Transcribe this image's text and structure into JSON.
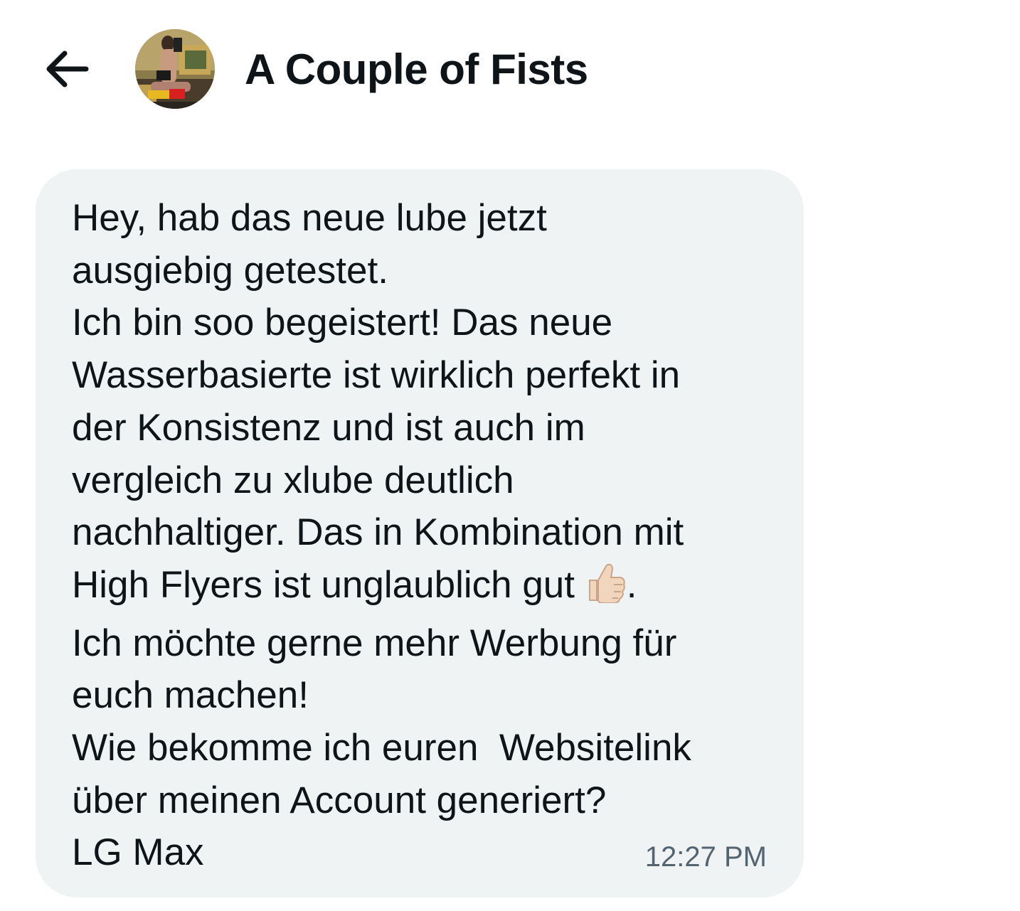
{
  "header": {
    "back_icon": "arrow-left-icon",
    "avatar": "profile-photo",
    "title": "A Couple of Fists"
  },
  "message": {
    "lines": [
      "Hey, hab das neue lube jetzt",
      "ausgiebig getestet.",
      "Ich bin soo begeistert! Das neue",
      "Wasserbasierte ist wirklich perfekt in",
      "der Konsistenz und ist auch im",
      "vergleich zu xlube deutlich",
      "nachhaltiger. Das in Kombination mit",
      "High Flyers ist unglaublich gut",
      "Ich möchte gerne mehr Werbung für",
      "euch machen!",
      "Wie bekomme ich euren  Websitelink",
      "über meinen Account generiert?",
      "LG Max"
    ],
    "emoji": "thumbs-up-icon",
    "emoji_suffix": ".",
    "timestamp": "12:27 PM"
  },
  "colors": {
    "bubble": "#eff3f4",
    "text": "#0f1419",
    "timestamp": "#536471"
  }
}
